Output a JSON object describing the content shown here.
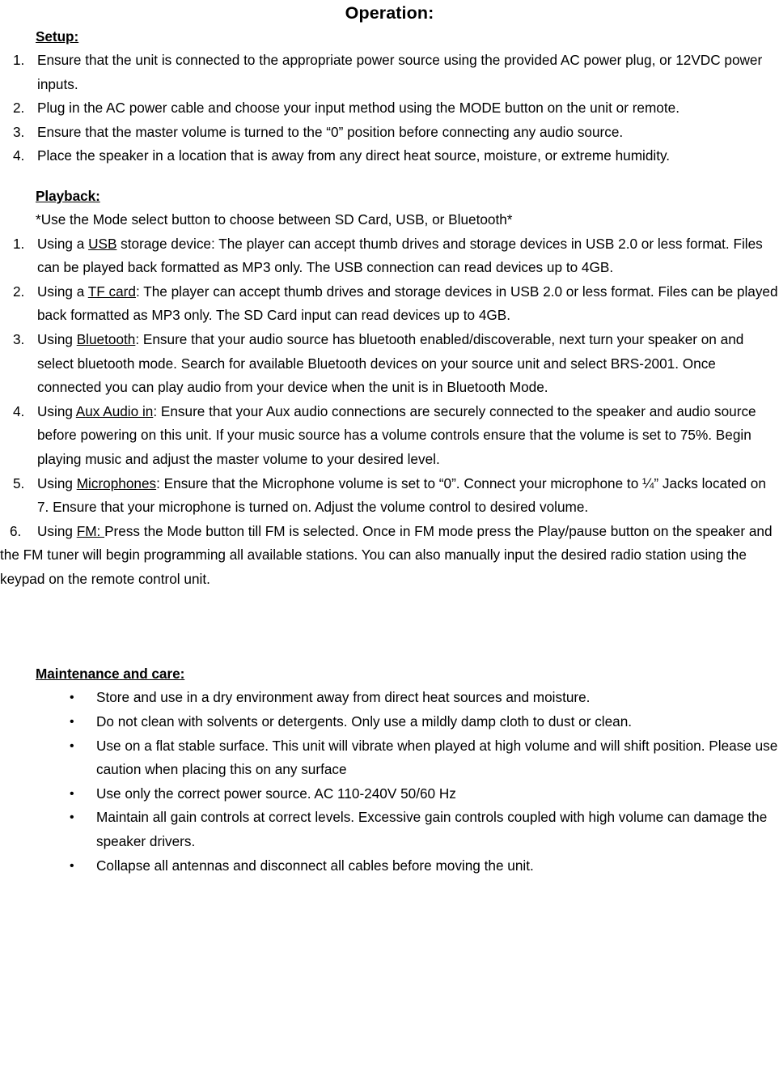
{
  "document": {
    "title": "Operation:",
    "sections": {
      "setup": {
        "heading": "Setup: ",
        "items": [
          {
            "num": "1.",
            "text": "Ensure that the unit is connected to the appropriate power source using the provided AC power plug, or 12VDC power inputs."
          },
          {
            "num": "2.",
            "text": "Plug in the AC power cable and choose your input method using the MODE button on the unit or remote."
          },
          {
            "num": "3.",
            "text": "Ensure that the master volume is turned to the “0” position before connecting any audio source."
          },
          {
            "num": "4.",
            "text": "Place the speaker in a location that is away from any direct heat source, moisture, or extreme humidity."
          }
        ]
      },
      "playback": {
        "heading": "Playback:",
        "note": "*Use the Mode select button to choose between SD Card, USB, or Bluetooth*",
        "items": [
          {
            "num": "1.",
            "pre": "Using a ",
            "underlined": "USB",
            "post": " storage device: The player can accept thumb drives and storage devices in USB 2.0 or less format. Files can be played back formatted as MP3 only. The USB connection can read devices up to 4GB."
          },
          {
            "num": "2.",
            "pre": "Using a ",
            "underlined": "TF card",
            "post": ": The player can accept thumb drives and storage devices in USB 2.0 or less format. Files can be played back formatted as MP3 only. The SD Card input can read devices up to 4GB."
          },
          {
            "num": "3.",
            "pre": "Using ",
            "underlined": "Bluetooth",
            "post": ":  Ensure that your audio source has bluetooth enabled/discoverable, next turn your speaker on and select bluetooth mode. Search for available Bluetooth devices on your source unit and select BRS-2001. Once connected you can play audio from your device when the unit is in Bluetooth Mode."
          },
          {
            "num": "4.",
            "pre": "Using ",
            "underlined": "Aux Audio in",
            "post": ": Ensure that your Aux audio connections are securely connected to the speaker and audio source before powering on this unit. If your music source has a volume controls ensure that the volume is set to 75%. Begin playing music and adjust the master volume to your desired level."
          },
          {
            "num": "5.",
            "pre": "Using ",
            "underlined": "Microphones",
            "post": ":  Ensure that the Microphone volume is set to “0”. Connect your microphone to ¼” Jacks located on 7. Ensure that your microphone is turned on. Adjust the volume control to desired volume."
          },
          {
            "num": "6.",
            "pre": "Using ",
            "underlined": "FM: ",
            "post": "Press the Mode button till FM is selected. Once in FM mode press the Play/pause button on the speaker and the FM tuner will begin programming all available stations. You can also manually input the desired radio station using the keypad on the remote control unit."
          }
        ]
      },
      "maintenance": {
        "heading": "Maintenance and care:",
        "bullet_glyph": "•",
        "items": [
          {
            "text": "Store and use in a dry environment away from direct heat sources and moisture."
          },
          {
            "text": "Do not clean with solvents or detergents. Only use a mildly damp cloth to dust or clean."
          },
          {
            "text": "Use on a flat stable surface. This unit will vibrate when played at high volume and will shift position. Please use caution when placing this on any surface"
          },
          {
            "text": "Use only the correct power source. AC  110-240V 50/60 Hz"
          },
          {
            "text": "Maintain all gain controls at correct levels. Excessive gain controls coupled with high volume can damage the speaker drivers."
          },
          {
            "text": "Collapse all antennas and disconnect all cables before moving the unit."
          }
        ]
      }
    }
  }
}
